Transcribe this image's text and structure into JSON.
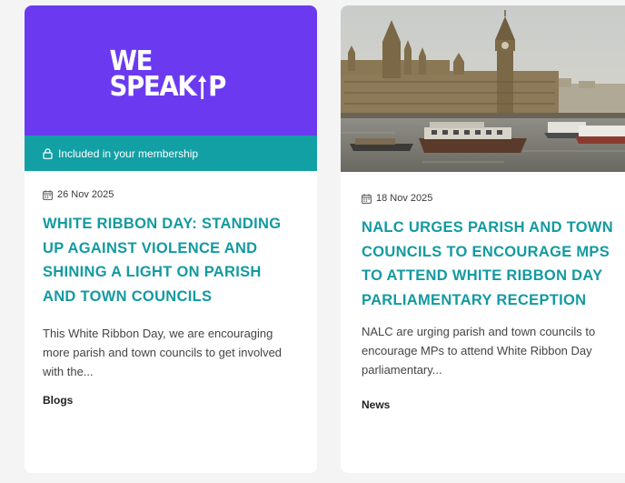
{
  "cards": [
    {
      "logo_line1": "WE",
      "logo_line2_left": "SPEAK",
      "logo_line2_right": "P",
      "membership_label": "Included in your membership",
      "date": "26 Nov 2025",
      "title": "WHITE RIBBON DAY: STANDING UP AGAINST VIOLENCE AND SHINING A LIGHT ON PARISH AND TOWN COUNCILS",
      "excerpt": "This White Ribbon Day, we are encouraging more parish and town councils to get involved with the...",
      "category": "Blogs",
      "colors": {
        "hero": "#6b3af0",
        "bar": "#12a0a5",
        "title": "#139aa0"
      },
      "icons": [
        "lock-icon",
        "calendar-icon",
        "arrow-up-icon"
      ]
    },
    {
      "date": "18 Nov 2025",
      "title": "NALC URGES PARISH AND TOWN COUNCILS TO ENCOURAGE MPS TO ATTEND WHITE RIBBON DAY PARLIAMENTARY RECEPTION",
      "excerpt": "NALC are urging parish and town councils to encourage MPs to attend White Ribbon Day parliamentary...",
      "category": "News",
      "icons": [
        "calendar-icon"
      ]
    }
  ]
}
